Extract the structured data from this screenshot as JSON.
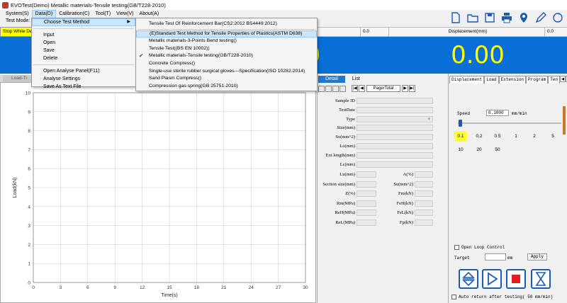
{
  "window": {
    "title": "EVOTest(Demo) Metallic materials-Tensile testing(GB/T228-2010)"
  },
  "menu": [
    {
      "label": "System(S)"
    },
    {
      "label": "Data(D)"
    },
    {
      "label": "Calibration(C)"
    },
    {
      "label": "Tool(T)"
    },
    {
      "label": "View(V)"
    },
    {
      "label": "About(A)"
    }
  ],
  "test_mode_label": "Test Mode:",
  "status": {
    "stop_while": "Stop While De",
    "cell_value": "0.0",
    "displacement_label": "Displacement(mm)",
    "displacement_cell": "0.0"
  },
  "displays": {
    "left_value": "0",
    "right_value": "0.00",
    "color": "#0a6fd6",
    "digit_color": "#ffff00"
  },
  "data_menu": {
    "items": [
      {
        "label": "Choose Test Method",
        "submenu": true
      },
      {
        "label": "Input"
      },
      {
        "label": "Open"
      },
      {
        "label": "Save"
      },
      {
        "label": "Delete"
      },
      {
        "label": "Open Analyse Panel(F11)"
      },
      {
        "label": "Analyse Settings"
      },
      {
        "label": "Save As Text File"
      }
    ]
  },
  "method_menu": {
    "items": [
      {
        "label": "Tensile Test Of Reinforcement Bar(CS2:2012  BS4449:2012)"
      },
      {
        "label": "(E)Standard Test Method for Tensile Properties of Plastics(ASTM D638)",
        "highlight": true
      },
      {
        "label": "Metallic materials-3-Points Bend testing()"
      },
      {
        "label": "Tensile Test((BS EN 10002))"
      },
      {
        "label": "Metallic materials-Tensile testing(GB/T228-2010)",
        "checked": true
      },
      {
        "label": "Concrete Compress()"
      },
      {
        "label": "Single-use sterile rubber surgical gloves---Specification(ISO 10282-2014)"
      },
      {
        "label": "Sand Plasm Compress()"
      },
      {
        "label": "Compression gas spring(GB 25751-2010)"
      }
    ]
  },
  "chart": {
    "tab_label": "Load-Ti",
    "chart_data": {
      "type": "line",
      "xlabel": "Time(s)",
      "ylabel": "Load(kN)",
      "xlim": [
        0,
        30
      ],
      "ylim": [
        0,
        10
      ],
      "x_ticks": [
        0,
        3,
        6,
        9,
        12,
        15,
        18,
        21,
        24,
        27,
        30
      ],
      "y_ticks": [
        0,
        1,
        2,
        3,
        4,
        5,
        6,
        7,
        8,
        9,
        10
      ],
      "grid": true,
      "series": []
    }
  },
  "detail": {
    "tabs": [
      {
        "label": "Detail",
        "active": true
      },
      {
        "label": "List"
      }
    ],
    "page_total": "PagerTotal",
    "fields": [
      {
        "label": "Sample ID"
      },
      {
        "label": "TestDate"
      },
      {
        "label": "Type"
      },
      {
        "label": "Size(mm)"
      },
      {
        "label": "So(mm^2)"
      },
      {
        "label": "Lo(mm)"
      },
      {
        "label": "Ext length(mm)"
      },
      {
        "label": "Lc(mm)"
      }
    ],
    "pairs": [
      [
        "Lu(mm)",
        "A(%)"
      ],
      [
        "Section size(mm)",
        "Su(mm^2)"
      ],
      [
        "Z(%)",
        "Fm(kN)"
      ],
      [
        "Rm(MPa)",
        "FeH(kN)"
      ],
      [
        "ReH(MPa)",
        "FeL(kN)"
      ],
      [
        "ReL(MPa)",
        "Fp(kN)"
      ]
    ]
  },
  "control": {
    "tabs": [
      "Displacement",
      "Load",
      "Extension",
      "Program",
      "Ten"
    ],
    "speed_label": "Speed",
    "speed_value": "0.1000",
    "speed_unit": "mm/min",
    "speed_level": 0.02,
    "speeds_row1": [
      "0.1",
      "0.2",
      "0.5",
      "1",
      "2",
      "5"
    ],
    "speeds_row2": [
      "10",
      "20",
      "50"
    ],
    "selected_speed": "0.1",
    "open_loop_label": "Open Loop Control",
    "target_label": "Target",
    "target_unit": "mm",
    "apply_label": "Apply",
    "auto_return_label": "Auto return after testing( 50  mm/min)"
  }
}
